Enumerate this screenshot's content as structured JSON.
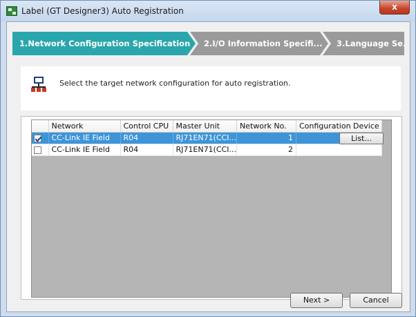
{
  "window": {
    "title": "Label (GT Designer3) Auto Registration",
    "close_label": "x"
  },
  "wizard": {
    "steps": [
      {
        "label": "1.Network Configuration Specification",
        "active": true
      },
      {
        "label": "2.I/O Information Specifi...",
        "active": false
      },
      {
        "label": "3.Language Se...",
        "active": false
      }
    ]
  },
  "instruction": {
    "icon": "network-icon",
    "text": "Select the target network configuration for auto registration."
  },
  "grid": {
    "columns": [
      "",
      "Network",
      "Control CPU",
      "Master Unit",
      "Network No.",
      "Configuration Device"
    ],
    "rows": [
      {
        "checked": true,
        "network": "CC-Link IE Field",
        "cpu": "R04",
        "master": "RJ71EN71(CCI...",
        "network_no": "1",
        "config_button": "List...",
        "selected": true
      },
      {
        "checked": false,
        "network": "CC-Link IE Field",
        "cpu": "R04",
        "master": "RJ71EN71(CCI...",
        "network_no": "2",
        "config_button": "",
        "selected": false
      }
    ]
  },
  "buttons": {
    "next": "Next >",
    "cancel": "Cancel"
  },
  "colors": {
    "active_step": "#2aa6ad",
    "inactive_step": "#9a9a9a",
    "selection": "#3d95d8"
  }
}
